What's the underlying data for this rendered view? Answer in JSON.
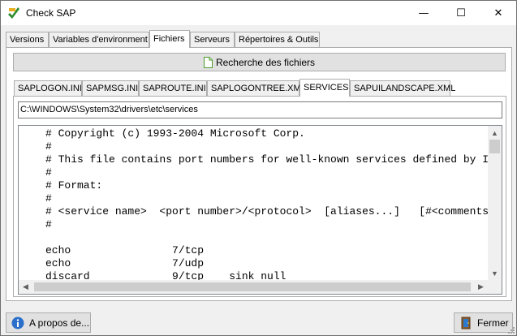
{
  "window": {
    "title": "Check SAP"
  },
  "title_buttons": {
    "minimize": "—",
    "maximize": "☐",
    "close": "✕"
  },
  "top_tabs": [
    {
      "label": "Versions",
      "active": false
    },
    {
      "label": "Variables d'environment",
      "active": false
    },
    {
      "label": "Fichiers",
      "active": true
    },
    {
      "label": "Serveurs",
      "active": false
    },
    {
      "label": "Répertoires & Outils",
      "active": false
    }
  ],
  "search_button": {
    "label": "Recherche des fichiers",
    "icon": "document-icon"
  },
  "inner_tabs": [
    {
      "label": "SAPLOGON.INI",
      "active": false
    },
    {
      "label": "SAPMSG.INI",
      "active": false
    },
    {
      "label": "SAPROUTE.INI",
      "active": false
    },
    {
      "label": "SAPLOGONTREE.XML",
      "active": false
    },
    {
      "label": "SERVICES",
      "active": true
    },
    {
      "label": "SAPUILANDSCAPE.XML",
      "active": false
    }
  ],
  "path_field": {
    "value": "C:\\WINDOWS\\System32\\drivers\\etc\\services"
  },
  "file_content": [
    "# Copyright (c) 1993-2004 Microsoft Corp.",
    "#",
    "# This file contains port numbers for well-known services defined by IANA",
    "#",
    "# Format:",
    "#",
    "# <service name>  <port number>/<protocol>  [aliases...]   [#<comments>]",
    "#",
    "",
    "echo                7/tcp",
    "echo                7/udp",
    "discard             9/tcp    sink null"
  ],
  "bottom": {
    "about_label": "A propos de...",
    "close_label": "Fermer"
  },
  "colors": {
    "window_bg": "#f0f0f0",
    "button_bg": "#e1e1e1",
    "border": "#adadad"
  }
}
